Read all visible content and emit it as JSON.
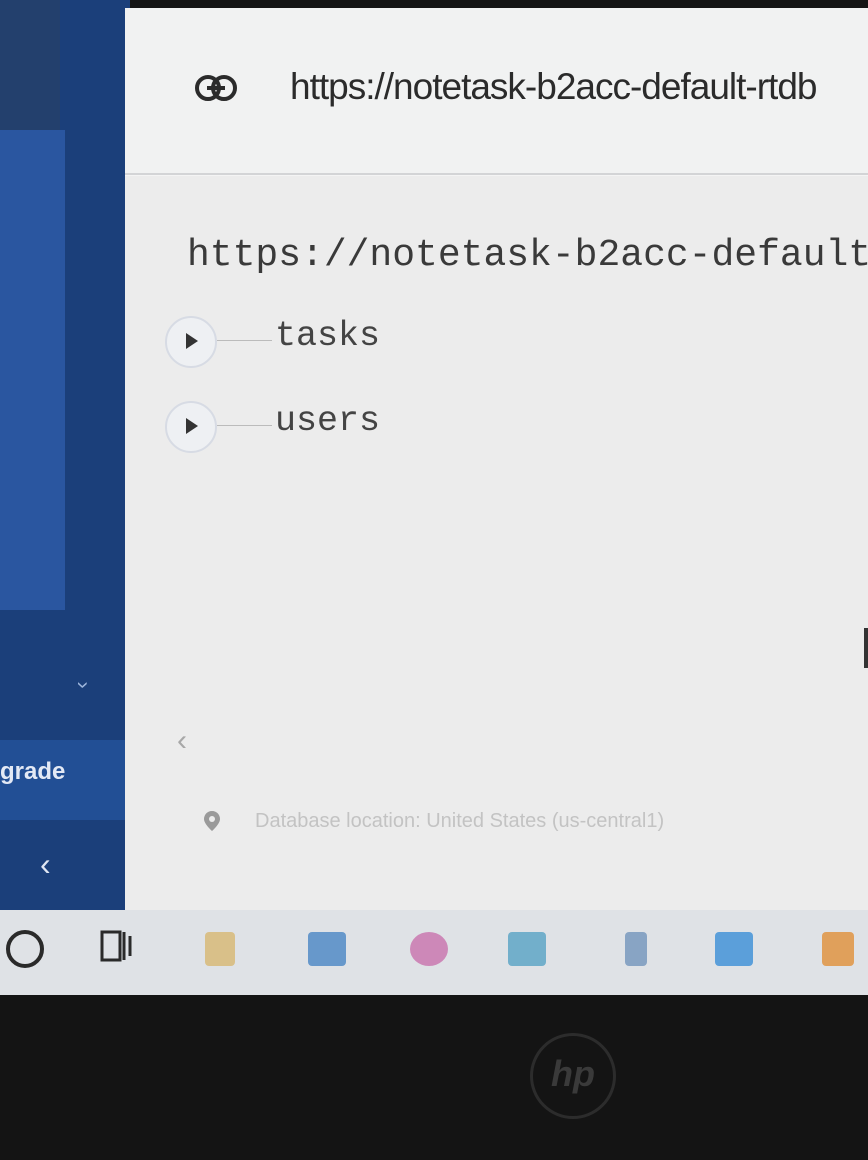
{
  "sidebar": {
    "upgrade_label": "grade",
    "collapse_icon": "chevron-left-icon",
    "expand_icon": "chevron-down-icon"
  },
  "urlbar": {
    "link_icon": "link-icon",
    "url": "https://notetask-b2acc-default-rtdb"
  },
  "database": {
    "root_url": "https://notetask-b2acc-default-",
    "nodes": [
      {
        "key": "tasks"
      },
      {
        "key": "users"
      }
    ]
  },
  "footer": {
    "location_icon": "map-pin-icon",
    "location_text": "Database location: United States (us-central1)"
  },
  "taskbar": {
    "apps": [
      "start-circle-icon",
      "task-view-icon",
      "sublime-icon",
      "store-icon",
      "browser-icon",
      "mail-icon",
      "app-icon",
      "vscode-icon",
      "vlc-icon"
    ]
  },
  "colors": {
    "sidebar": "#1b3f7a",
    "accent_blue": "#2a56a0",
    "content_bg": "#ececec"
  },
  "bezel": {
    "logo": "hp"
  }
}
